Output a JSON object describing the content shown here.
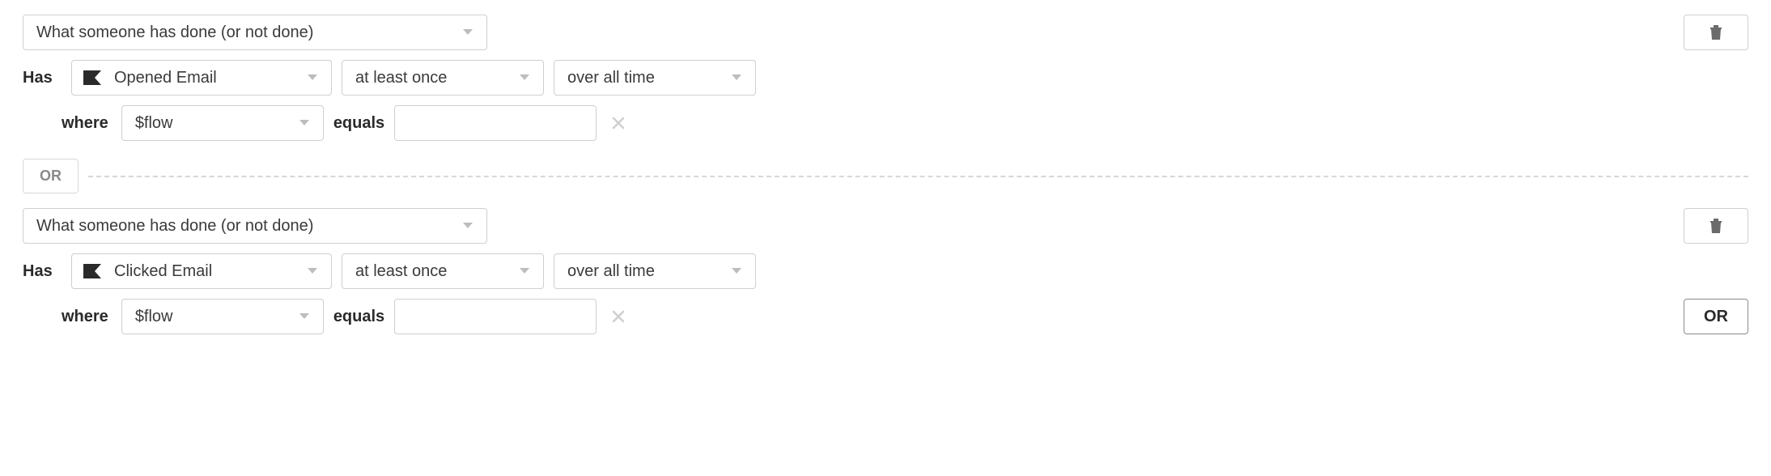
{
  "labels": {
    "has": "Has",
    "where": "where",
    "equals": "equals",
    "or": "OR"
  },
  "conditions": [
    {
      "type": "What someone has done (or not done)",
      "metric": "Opened Email",
      "frequency": "at least once",
      "time_range": "over all time",
      "filter_property": "$flow",
      "filter_value": ""
    },
    {
      "type": "What someone has done (or not done)",
      "metric": "Clicked Email",
      "frequency": "at least once",
      "time_range": "over all time",
      "filter_property": "$flow",
      "filter_value": ""
    }
  ]
}
